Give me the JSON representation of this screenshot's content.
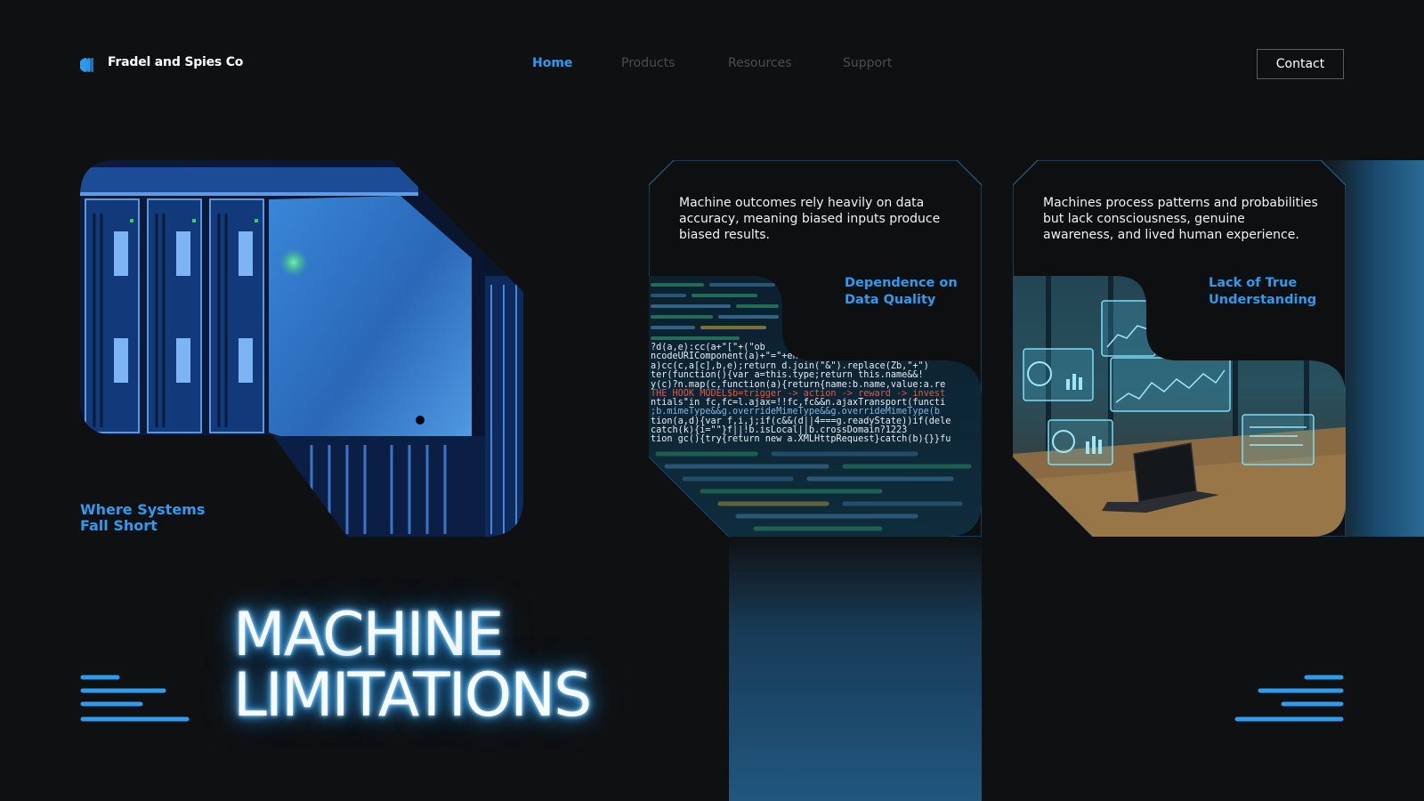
{
  "header": {
    "brand": "Fradel and Spies Co",
    "nav": [
      {
        "label": "Home",
        "active": true
      },
      {
        "label": "Products",
        "active": false
      },
      {
        "label": "Resources",
        "active": false
      },
      {
        "label": "Support",
        "active": false
      }
    ],
    "contact_label": "Contact"
  },
  "hero": {
    "caption": "Where Systems Fall Short",
    "title_line1": "MACHINE",
    "title_line2": "LIMITATIONS"
  },
  "cards": [
    {
      "text": "Machine outcomes rely heavily on data accuracy, meaning biased inputs produce biased results.",
      "title": "Dependence on Data Quality",
      "code_lines": [
        "?d(a,e):cc(a+\"[\"+(\"ob",
        "ncodeURIComponent(a)+\"=\"+encodeURIComponent(b));if",
        "a)cc(c,a[c],b,e);return d.join(\"&\").replace(Zb,\"+\")",
        "ter(function(){var a=this.type;return this.name&&!",
        "y(c)?n.map(c,function(a){return{name:b.name,value:a.re",
        "THE HOOK MODEL$b=trigger -> action -> reward -> invest",
        "ntials\"in fc,fc=l.ajax=!!fc,fc&&n.ajaxTransport(functi",
        ";b.mimeType&&g.overrideMimeType&&g.overrideMimeType(b",
        "tion(a,d){var f,i,j;if(c&&(d||4===g.readyState))if(dele",
        "catch(k){i=\"\"}f||!b.isLocal||b.crossDomain?1223",
        "tion gc(){try{return new a.XMLHttpRequest}catch(b){}}fu"
      ]
    },
    {
      "text": "Machines process patterns and probabilities but lack consciousness, genuine awareness, and lived human experience.",
      "title": "Lack of True Understanding"
    }
  ],
  "colors": {
    "accent": "#2f9bf0",
    "background": "#0f1011",
    "glow": "#4fb8ff"
  },
  "icons": {
    "logo": "brand-logo-icon",
    "deco": "speed-lines-icon"
  }
}
